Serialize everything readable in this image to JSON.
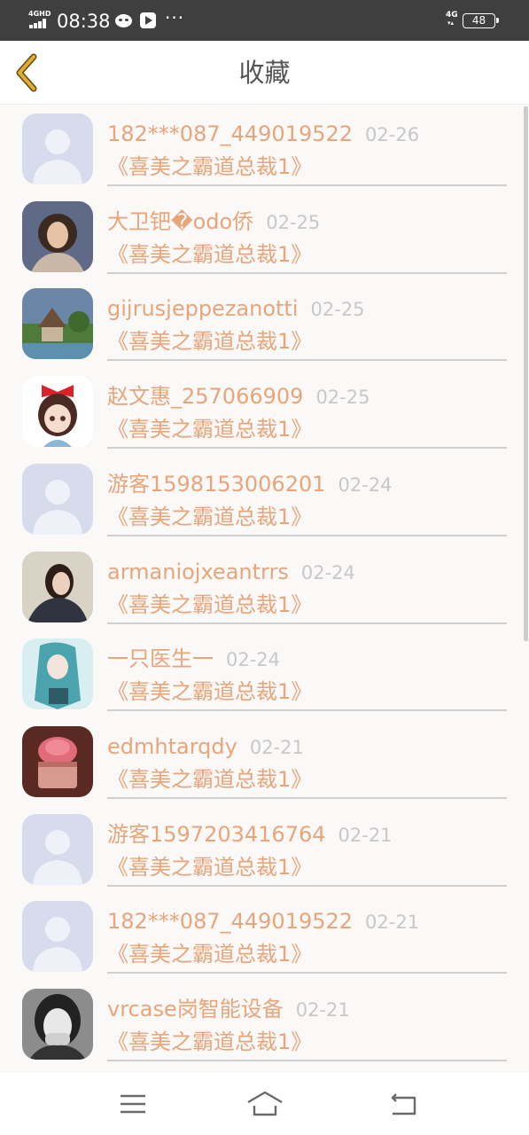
{
  "status_bar": {
    "network": "4GHD",
    "time": "08:38",
    "dots": "···",
    "network_right": "4G",
    "battery": "48",
    "icons": [
      "signal-icon",
      "cat-icon",
      "play-icon",
      "battery-icon"
    ]
  },
  "header": {
    "title": "收藏",
    "back_icon": "chevron-left-icon",
    "accent_color": "#d8a32c"
  },
  "list": {
    "name_color": "#e8a57a",
    "date_color": "#c8c8c8",
    "items": [
      {
        "name": "182***087_449019522",
        "date": "02-26",
        "title": "《喜美之霸道总裁1》",
        "avatar": "default-avatar"
      },
      {
        "name": "大卫钯�odo侨",
        "date": "02-25",
        "title": "《喜美之霸道总裁1》",
        "avatar": "photo-avatar-girl-curly-hair"
      },
      {
        "name": "gijrusjeppezanotti",
        "date": "02-25",
        "title": "《喜美之霸道总裁1》",
        "avatar": "photo-avatar-garden-house"
      },
      {
        "name": "赵文惠_257066909",
        "date": "02-25",
        "title": "《喜美之霸道总裁1》",
        "avatar": "cartoon-avatar-girl-red-bow"
      },
      {
        "name": "游客1598153006201",
        "date": "02-24",
        "title": "《喜美之霸道总裁1》",
        "avatar": "default-avatar"
      },
      {
        "name": "armaniojxeantrrs",
        "date": "02-24",
        "title": "《喜美之霸道总裁1》",
        "avatar": "photo-avatar-girl-dark-hair"
      },
      {
        "name": "一只医生一",
        "date": "02-24",
        "title": "《喜美之霸道总裁1》",
        "avatar": "anime-avatar-teal-hair"
      },
      {
        "name": "edmhtarqdy",
        "date": "02-21",
        "title": "《喜美之霸道总裁1》",
        "avatar": "photo-avatar-pink-cupcake"
      },
      {
        "name": "游客1597203416764",
        "date": "02-21",
        "title": "《喜美之霸道总裁1》",
        "avatar": "default-avatar"
      },
      {
        "name": "182***087_449019522",
        "date": "02-21",
        "title": "《喜美之霸道总裁1》",
        "avatar": "default-avatar"
      },
      {
        "name": "vrcase岗智能设备",
        "date": "02-21",
        "title": "《喜美之霸道总裁1》",
        "avatar": "photo-avatar-bw-girl"
      }
    ]
  },
  "bottom_nav": {
    "icons": [
      "menu-icon",
      "home-icon",
      "back-icon"
    ]
  }
}
